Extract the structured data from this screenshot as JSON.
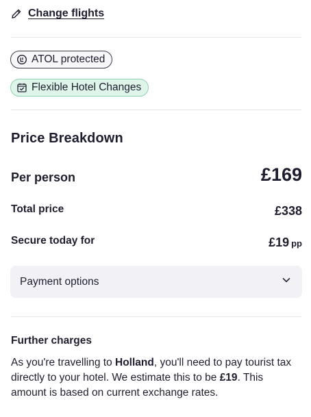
{
  "change_flights": {
    "icon": "pencil-icon",
    "label": "Change flights"
  },
  "badges": [
    {
      "icon": "atol-shield-icon",
      "label": "ATOL protected"
    },
    {
      "icon": "calendar-check-icon",
      "label": "Flexible Hotel Changes"
    }
  ],
  "price_breakdown": {
    "title": "Price Breakdown",
    "per_person_label": "Per person",
    "per_person_value": "£169",
    "total_label": "Total price",
    "total_value": "£338",
    "secure_label": "Secure today for",
    "secure_value": "£19",
    "secure_unit": "pp"
  },
  "payment_options": {
    "label": "Payment options",
    "icon": "chevron-down-icon"
  },
  "further_charges": {
    "title": "Further charges",
    "text_1": "As you're travelling to ",
    "destination": "Holland",
    "text_2": ", you'll need to pay tourist tax directly to your hotel. We estimate this to be ",
    "amount": "£19",
    "text_3": ". This amount is based on current exchange rates."
  },
  "colors": {
    "text": "#1d1d2e",
    "divider": "#e3e3e8",
    "flex_badge_bg": "#dff5ea",
    "flex_badge_border": "#8fd0b0",
    "payment_bg": "#f1f1f6"
  }
}
